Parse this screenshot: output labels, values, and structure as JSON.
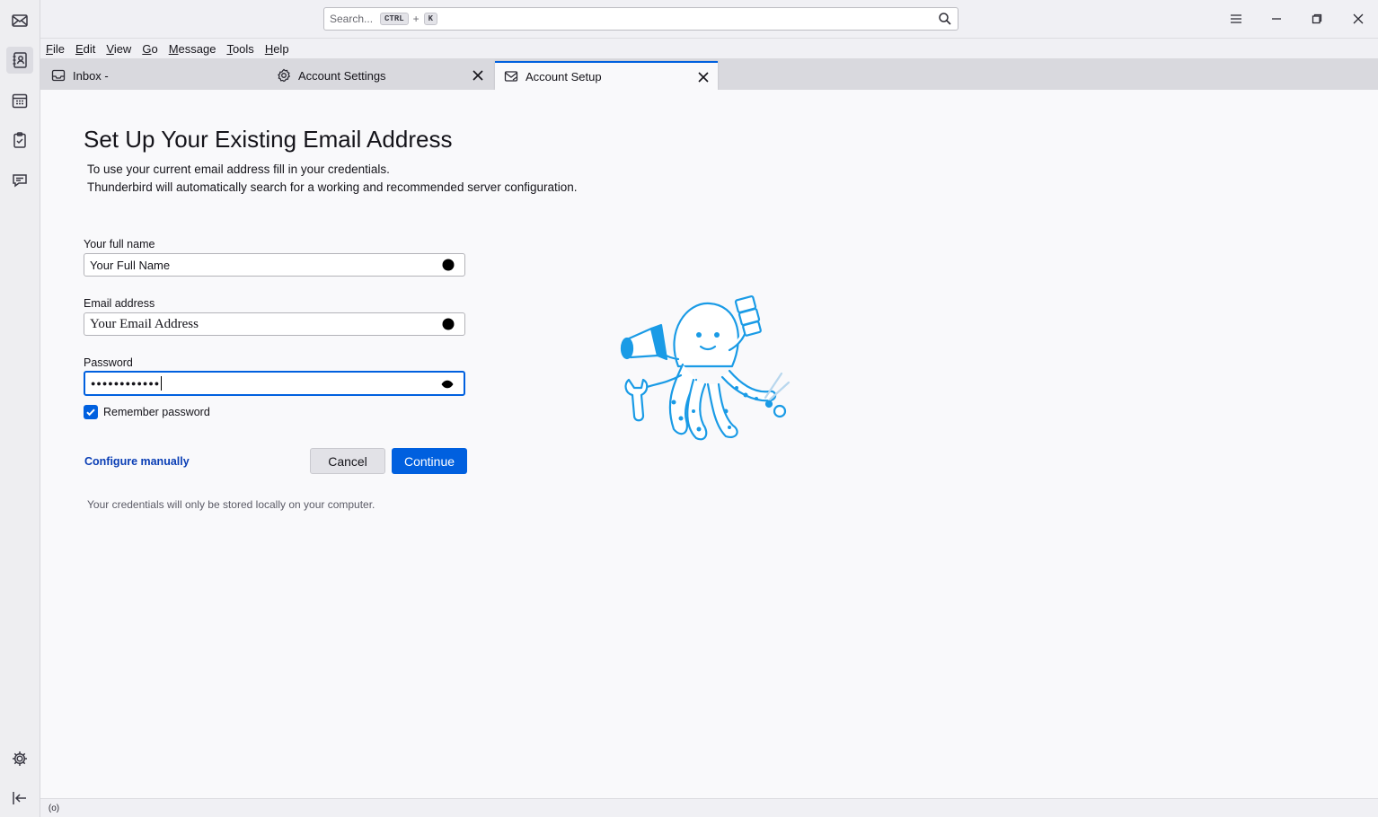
{
  "titlebar": {
    "search_placeholder": "Search...",
    "search_key1": "CTRL",
    "search_plus": "+",
    "search_key2": "K"
  },
  "menu": {
    "items": [
      {
        "underline": "F",
        "rest": "ile"
      },
      {
        "underline": "E",
        "rest": "dit"
      },
      {
        "underline": "V",
        "rest": "iew"
      },
      {
        "underline": "G",
        "rest": "o"
      },
      {
        "underline": "M",
        "rest": "essage"
      },
      {
        "underline": "T",
        "rest": "ools"
      },
      {
        "underline": "H",
        "rest": "elp"
      }
    ]
  },
  "tabs": [
    {
      "label": "Inbox -",
      "icon": "inbox-icon"
    },
    {
      "label": "Account Settings",
      "icon": "gear-icon"
    },
    {
      "label": "Account Setup",
      "icon": "mail-icon"
    }
  ],
  "setup": {
    "heading": "Set Up Your Existing Email Address",
    "desc_line1": "To use your current email address fill in your credentials.",
    "desc_line2": "Thunderbird will automatically search for a working and recommended server configuration.",
    "fullname_label": "Your full name",
    "fullname_value": "Your Full Name",
    "email_label": "Email address",
    "email_value": "Your Email Address",
    "password_label": "Password",
    "password_value": "●●●●●●●●●●●●",
    "remember_label": "Remember password",
    "remember_checked": true,
    "configure_link": "Configure manually",
    "cancel_label": "Cancel",
    "continue_label": "Continue",
    "note": "Your credentials will only be stored locally on your computer."
  },
  "status": {
    "activity_icon": "(o)"
  },
  "colors": {
    "accent": "#0060df",
    "link": "#0a3eb5",
    "mascot": "#1a9be6"
  }
}
